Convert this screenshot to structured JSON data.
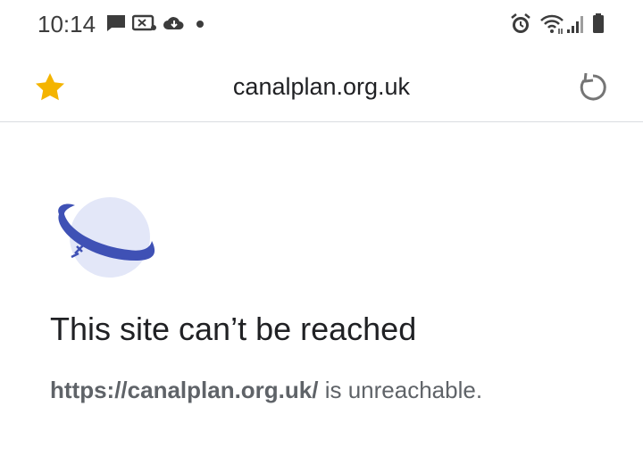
{
  "status_bar": {
    "time": "10:14",
    "icons_left": [
      "message-icon",
      "cast-icon",
      "cloud-sync-icon",
      "dot-icon"
    ],
    "icons_right": [
      "alarm-icon",
      "wifi-icon",
      "signal-icon",
      "battery-icon"
    ]
  },
  "toolbar": {
    "url": "canalplan.org.uk",
    "star_icon": "star-icon",
    "reload_icon": "reload-icon"
  },
  "error": {
    "icon": "globe-icon",
    "title": "This site can’t be reached",
    "url": "https://canalplan.org.uk/",
    "message_suffix": " is unreachable."
  },
  "colors": {
    "accent": "#3f51b5",
    "globe_fill": "#e3e7f8",
    "star": "#f4b400",
    "text": "#202124",
    "muted": "#5f6368"
  }
}
